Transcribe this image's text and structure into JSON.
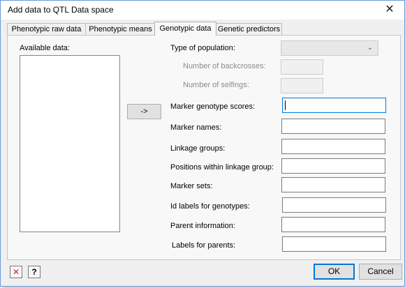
{
  "window": {
    "title": "Add data to QTL Data space",
    "close_glyph": "✕"
  },
  "tabs": [
    {
      "label": "Phenotypic raw data"
    },
    {
      "label": "Phenotypic means"
    },
    {
      "label": "Genotypic data"
    },
    {
      "label": "Genetic predictors"
    }
  ],
  "active_tab": "Genotypic data",
  "available_data": {
    "label": "Available data:",
    "items": []
  },
  "transfer_button": {
    "label": "->"
  },
  "type_of_population": {
    "label": "Type of population:",
    "value": ""
  },
  "number_of_backcrosses": {
    "label": "Number of backcrosses:",
    "value": ""
  },
  "number_of_selfings": {
    "label": "Number of selfings:",
    "value": ""
  },
  "fields": {
    "marker_genotype_scores": {
      "label": "Marker genotype scores:",
      "value": ""
    },
    "marker_names": {
      "label": "Marker names:",
      "value": ""
    },
    "linkage_groups": {
      "label": "Linkage groups:",
      "value": ""
    },
    "positions_within_linkage_group": {
      "label": "Positions within linkage group:",
      "value": ""
    },
    "marker_sets": {
      "label": "Marker sets:",
      "value": ""
    },
    "id_labels_for_genotypes": {
      "label": "Id labels for genotypes:",
      "value": ""
    },
    "parent_information": {
      "label": "Parent information:",
      "value": ""
    },
    "labels_for_parents": {
      "label": "Labels for parents:",
      "value": ""
    }
  },
  "footer": {
    "clear_icon": "✕",
    "help_icon": "?",
    "ok_label": "OK",
    "cancel_label": "Cancel"
  },
  "colors": {
    "accent": "#0078d7",
    "clear_icon": "#c42b1c"
  }
}
